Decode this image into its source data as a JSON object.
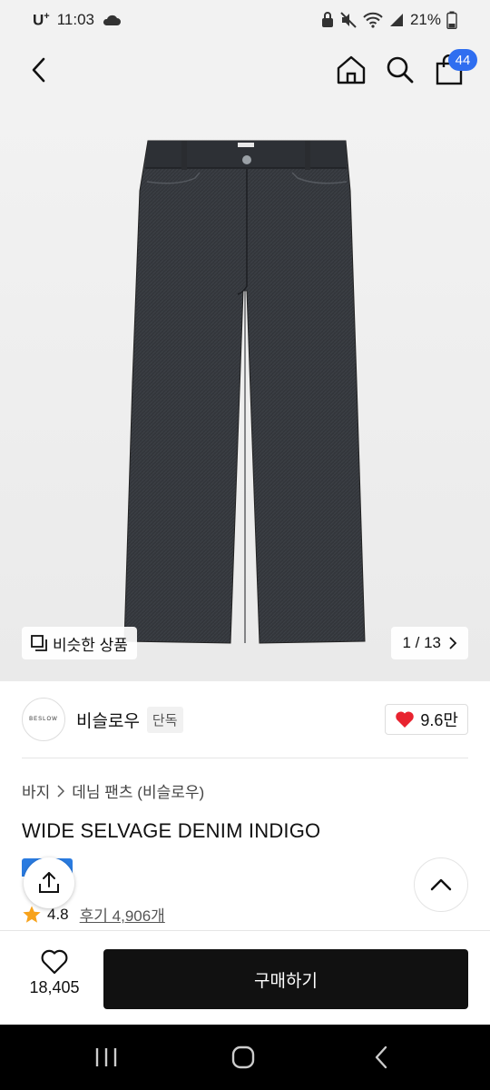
{
  "status": {
    "carrier": "U",
    "carrier_sup": "+",
    "time": "11:03",
    "battery": "21%"
  },
  "nav": {
    "cart_count": "44"
  },
  "image": {
    "similar_label": "비슷한 상품",
    "page_indicator": "1 / 13"
  },
  "brand": {
    "logo_text": "BESLOW",
    "name": "비슬로우",
    "exclusive": "단독",
    "likes": "9.6만"
  },
  "product": {
    "breadcrumb": [
      "바지",
      "데님 팬츠 (비슬로우)"
    ],
    "title": "WIDE SELVAGE DENIM INDIGO",
    "rating": "4.8",
    "reviews": "후기 4,906개"
  },
  "bottom": {
    "wish_count": "18,405",
    "buy_label": "구매하기"
  },
  "colors": {
    "accent_blue": "#2f6ef0",
    "heart_red": "#e8232f",
    "star_orange": "#f7a21b",
    "buy_button": "#111111"
  }
}
